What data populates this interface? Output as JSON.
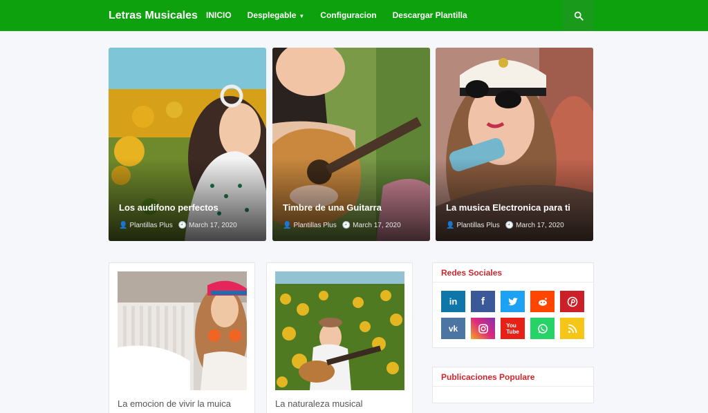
{
  "header": {
    "brand": "Letras Musicales",
    "nav": [
      {
        "label": "INICIO"
      },
      {
        "label": "Desplegable",
        "has_dropdown": true
      },
      {
        "label": "Configuracion"
      },
      {
        "label": "Descargar Plantilla"
      }
    ],
    "search_icon": "search-icon",
    "color": "#0da10d"
  },
  "featured": [
    {
      "title": "Los audifono perfectos",
      "author": "Plantillas Plus",
      "date": "March 17, 2020"
    },
    {
      "title": "Timbre de una Guitarra",
      "author": "Plantillas Plus",
      "date": "March 17, 2020"
    },
    {
      "title": "La musica Electronica para ti",
      "author": "Plantillas Plus",
      "date": "March 17, 2020"
    }
  ],
  "posts": [
    {
      "title": "La emocion de vivir la muica"
    },
    {
      "title": "La naturaleza musical"
    }
  ],
  "sidebar": {
    "social_title": "Redes Sociales",
    "social": [
      {
        "name": "linkedin",
        "label": "in",
        "color": "#0e76a8"
      },
      {
        "name": "facebook",
        "label": "f",
        "color": "#3b5998"
      },
      {
        "name": "twitter",
        "label": "t",
        "color": "#1da1f2"
      },
      {
        "name": "reddit",
        "label": "r",
        "color": "#ff4500"
      },
      {
        "name": "pinterest",
        "label": "p",
        "color": "#cb2027"
      },
      {
        "name": "vk",
        "label": "vk",
        "color": "#4c75a3"
      },
      {
        "name": "instagram",
        "label": "ig",
        "color": "#c13584"
      },
      {
        "name": "youtube",
        "label": "You Tube",
        "color": "#e62117"
      },
      {
        "name": "whatsapp",
        "label": "w",
        "color": "#25d366"
      },
      {
        "name": "rss",
        "label": "rss",
        "color": "#f5a623"
      }
    ],
    "popular_title": "Publicaciones Populare"
  }
}
